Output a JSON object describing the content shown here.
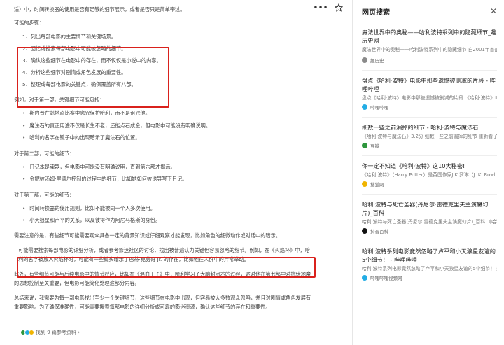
{
  "colors": {
    "accent_red": "#d9211c"
  },
  "left": {
    "lines_top": [
      "适）中，时间转换器的使用是否有足够的细节展示，或者是否只是简单带过。",
      "可能的步骤："
    ],
    "steps": [
      "1、列出每部电影的主要情节和关键场景。",
      "2、回忆或搜索每部电影中可能被忽略的细节。",
      "3、确认这些细节在电影中的存在，而不仅仅是小说中的内容。",
      "4、分析这些细节对剧情或角色发展的重要性。",
      "5、整理成每部电影的关键点，确保覆盖所有八部。"
    ],
    "example_intro": "例如，对于第一部，关键细节可能包括：",
    "example_bullets": [
      "斯内普在魁地奇比赛中念咒保护哈利，而不是诅咒他。",
      "魔法石的真正用途不仅是长生不老，还能点石成金，但电影中可能没有明确说明。",
      "哈利的名字在镜子中的出现暗示了魔法石的位置。"
    ],
    "second_intro": "对于第二部，可能的细节：",
    "second_bullets": [
      "日记本是魂器，但电影中可能没有明确说明，直到第六部才揭示。",
      "金妮被汤姆·里德尔控制的过程中的细节，比如她如何被诱导写下日记。"
    ],
    "third_intro": "对于第三部，可能的细节：",
    "third_bullets": [
      "时间转换器的使用规则，比如不能被同一个人多次使用。",
      "小天狼星和卢平的关系，以及彼得作为阿尼马格斯的身份。"
    ],
    "para_note": "需要注意的是，有些细节可能需要观众具备一定的背景知识或仔细观察才能发现，比如角色的细微动作或对话中的暗示。",
    "para_boxed": "可能需要搜索每部电影的详细分析，或者参考影迷社区的讨论，找出被普遍认为关键但容易忽略的细节。例如，在《火焰杯》中，哈利的名字被放入火焰杯时，可能有一些镜头暗示了巴蒂·克劳奇 Jr. 的存在，比如他在人群中的异常举动。",
    "para_more": "此外，有些细节可能与后续电影中的情节呼应，比如在《混血王子》中，哈利学习了大脑封闭术的过程，这对他在第七部中对抗伏地魔的思想控制至关重要，但电影可能简化处理这部分内容。",
    "para_summary": "总结来说，我需要为每一部电影找出至少一个关键细节，这些细节在电影中出现，但容易被大多数观众忽略，并且对剧情或角色发展有重要影响。为了确保准确性，可能需要搜索每部电影的详细分析或可靠的影迷资源，确认这些细节的存在和重要性。",
    "footer": "找到 9 篇参考资料 ›"
  },
  "right": {
    "title": "网页搜索",
    "results": [
      {
        "title": "魔法世界中的奥秘——哈利波特系列中的隐藏细节_趣历史网",
        "snippet": "魔法世界中的奥秘——哈利波特系列中的隐藏细节 自2001年首部电影《哈利·波特与魔法石》上映以来，这个…",
        "source": "趣历史",
        "color": "#8a8a8a"
      },
      {
        "title": "盘点《哈利·波特》电影中那些遗憾被删减的片段 - 哔哩哔哩",
        "snippet": "盘点《哈利·波特》电影中那些遗憾被删减的片段 《哈利·波特》电影的正片，在一些花絮或删除中我们还…",
        "source": "哔哩哔哩",
        "color": "#23ade5"
      },
      {
        "title": "细数一些之前漏掉的细节 - 哈利·波特与魔法石",
        "snippet": "《哈利·波特与魔法石》3.2分 细数一些之前漏掉的细节 重新看了一遍哈利波特与魔法石，和童年看的时候相比，发…",
        "source": "豆瓣",
        "color": "#2e963d"
      },
      {
        "title": "你一定不知道《哈利·波特》这10大秘密!",
        "snippet": "《哈利·波特》（Harry Potter）是英国作家J.K.罗琳（J. K. Rowling）于创作的魔幻文学系列小说，共7卷。打造了一…",
        "source": "搜狐网",
        "color": "#f0b400"
      },
      {
        "title": "哈利·波特与死亡圣器(丹尼尔·雷德克里夫主演魔幻片)_百科",
        "snippet": "哈利·波特与死亡圣器(丹尼尔·雷德克里夫主演魔幻片)_百科 《哈利·波特与死亡圣器》(Harry Potter and the…",
        "source": "抖音百科",
        "color": "#111111"
      },
      {
        "title": "哈利·波特系列电影竟然忽略了卢平和小天狼星友谊的5个细节！ - 哔哩哔哩",
        "snippet": "哈利·波特系列电影竟然忽略了卢平和小天狼星友谊的5个细节！ 感人旨向，由丹尼尔·雷德克里夫主演的《哈利…",
        "source": "哔哩哔哩视频网",
        "color": "#23ade5"
      }
    ]
  }
}
